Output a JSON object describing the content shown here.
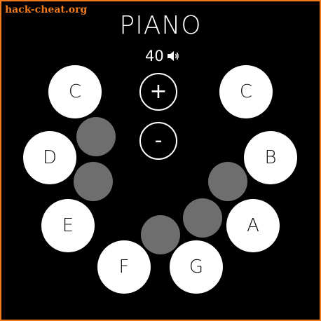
{
  "watermark": "hack-cheat.org",
  "title": "PIANO",
  "volume": {
    "value": "40",
    "icon": "speaker-icon"
  },
  "controls": {
    "increase_label": "+",
    "decrease_label": "-"
  },
  "white_keys": [
    "C",
    "D",
    "E",
    "F",
    "G",
    "A",
    "B",
    "C"
  ],
  "colors": {
    "background": "#000000",
    "frame": "#f07a1e",
    "white_key": "#ffffff",
    "black_key": "#6e6e6e",
    "text": "#ffffff"
  }
}
